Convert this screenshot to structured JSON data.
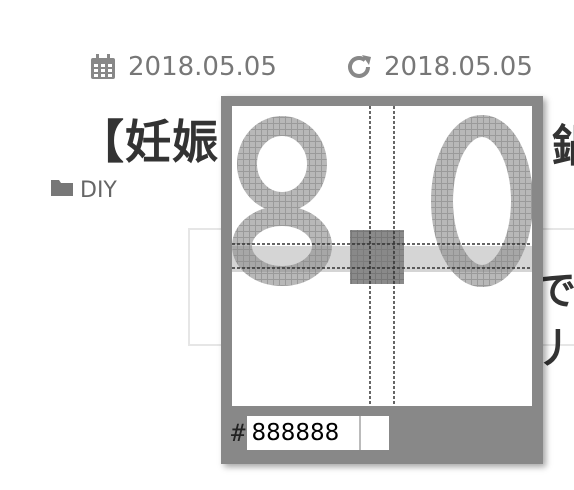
{
  "meta": {
    "published_date": "2018.05.05",
    "updated_date": "2018.05.05",
    "published_icon": "calendar-icon",
    "updated_icon": "refresh-icon"
  },
  "post": {
    "title_visible": "【妊娠8",
    "title_right_fragment": "鍋",
    "category": "DIY",
    "category_icon": "folder-icon",
    "box_right_fragment": "で丿"
  },
  "color_picker": {
    "hash_symbol": "#",
    "hex_value": "888888",
    "zoom_digits": "8.0",
    "sampled_color": "#888888"
  }
}
